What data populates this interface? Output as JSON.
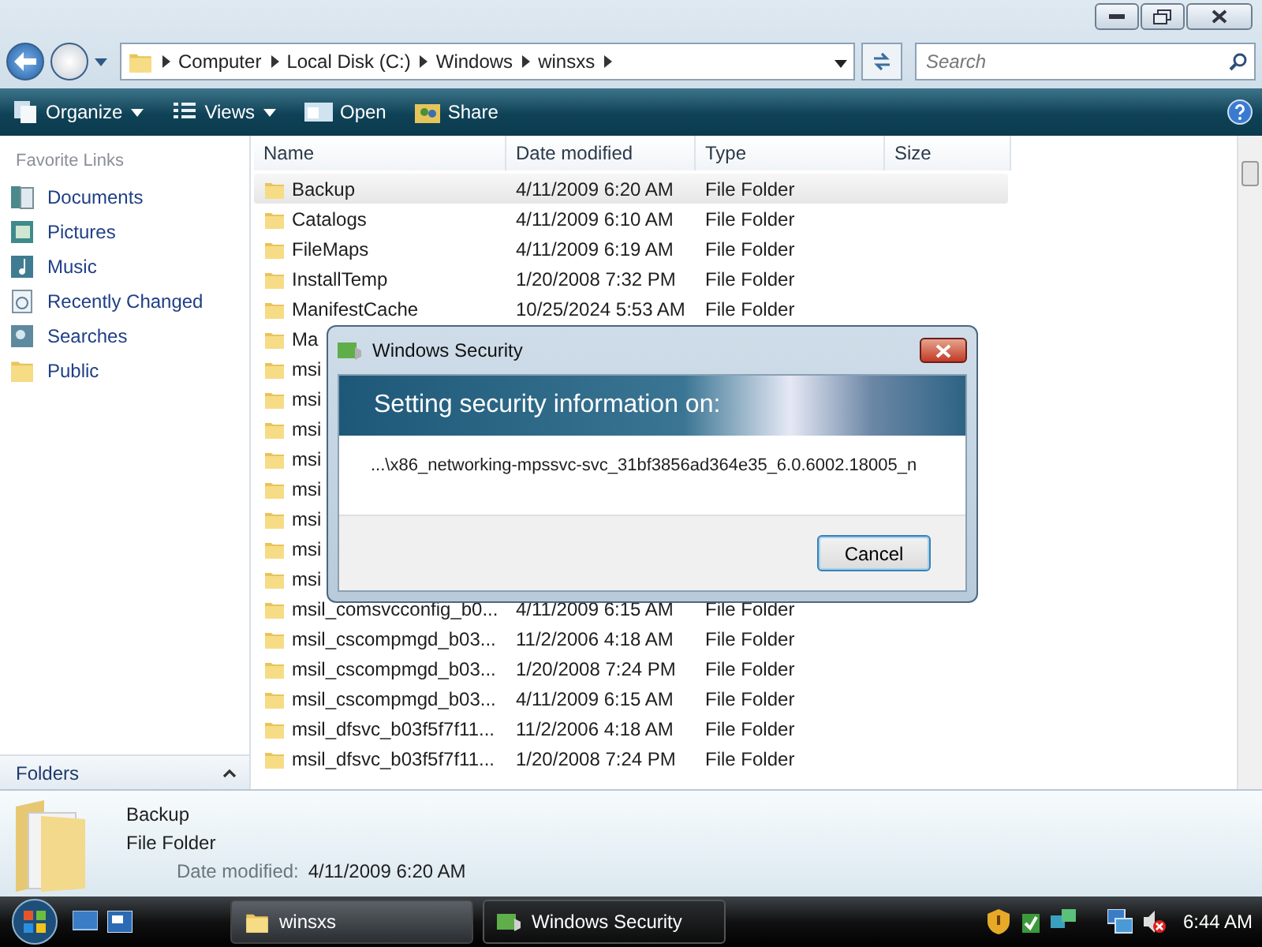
{
  "address_bar": {
    "crumbs": [
      "Computer",
      "Local Disk (C:)",
      "Windows",
      "winsxs"
    ]
  },
  "search": {
    "placeholder": "Search"
  },
  "toolbar": [
    {
      "label": "Organize",
      "kind": "menu"
    },
    {
      "label": "Views",
      "kind": "menu"
    },
    {
      "label": "Open",
      "kind": "plain"
    },
    {
      "label": "Share",
      "kind": "plain"
    }
  ],
  "sidebar": {
    "title": "Favorite Links",
    "items": [
      "Documents",
      "Pictures",
      "Music",
      "Recently Changed",
      "Searches",
      "Public"
    ],
    "folders_label": "Folders"
  },
  "table": {
    "columns": [
      "Name",
      "Date modified",
      "Type",
      "Size"
    ],
    "rows": [
      {
        "name": "Backup",
        "date": "4/11/2009 6:20 AM",
        "type": "File Folder",
        "selected": true
      },
      {
        "name": "Catalogs",
        "date": "4/11/2009 6:10 AM",
        "type": "File Folder",
        "selected": false
      },
      {
        "name": "FileMaps",
        "date": "4/11/2009 6:19 AM",
        "type": "File Folder",
        "selected": false
      },
      {
        "name": "InstallTemp",
        "date": "1/20/2008 7:32 PM",
        "type": "File Folder",
        "selected": false
      },
      {
        "name": "ManifestCache",
        "date": "10/25/2024 5:53 AM",
        "type": "File Folder",
        "selected": false
      },
      {
        "name": "Ma",
        "selected": false
      },
      {
        "name": "msi",
        "selected": false
      },
      {
        "name": "msi",
        "selected": false
      },
      {
        "name": "msi",
        "selected": false
      },
      {
        "name": "msi",
        "selected": false
      },
      {
        "name": "msi",
        "selected": false
      },
      {
        "name": "msi",
        "selected": false
      },
      {
        "name": "msi",
        "selected": false
      },
      {
        "name": "msi",
        "selected": false
      },
      {
        "name": "msil_comsvcconfig_b0...",
        "date": "4/11/2009 6:15 AM",
        "type": "File Folder",
        "selected": false
      },
      {
        "name": "msil_cscompmgd_b03...",
        "date": "11/2/2006 4:18 AM",
        "type": "File Folder",
        "selected": false
      },
      {
        "name": "msil_cscompmgd_b03...",
        "date": "1/20/2008 7:24 PM",
        "type": "File Folder",
        "selected": false
      },
      {
        "name": "msil_cscompmgd_b03...",
        "date": "4/11/2009 6:15 AM",
        "type": "File Folder",
        "selected": false
      },
      {
        "name": "msil_dfsvc_b03f5f7f11...",
        "date": "11/2/2006 4:18 AM",
        "type": "File Folder",
        "selected": false
      },
      {
        "name": "msil_dfsvc_b03f5f7f11...",
        "date": "1/20/2008 7:24 PM",
        "type": "File Folder",
        "selected": false
      }
    ]
  },
  "dialog": {
    "title": "Windows Security",
    "heading": "Setting security information on:",
    "path": "...\\x86_networking-mpssvc-svc_31bf3856ad364e35_6.0.6002.18005_n",
    "button": "Cancel"
  },
  "details": {
    "name": "Backup",
    "type": "File Folder",
    "date_label": "Date modified:",
    "date": "4/11/2009 6:20 AM"
  },
  "taskbar": {
    "buttons": [
      {
        "label": "winsxs",
        "selected": false
      },
      {
        "label": "Windows Security",
        "selected": true
      }
    ],
    "clock": "6:44 AM"
  }
}
